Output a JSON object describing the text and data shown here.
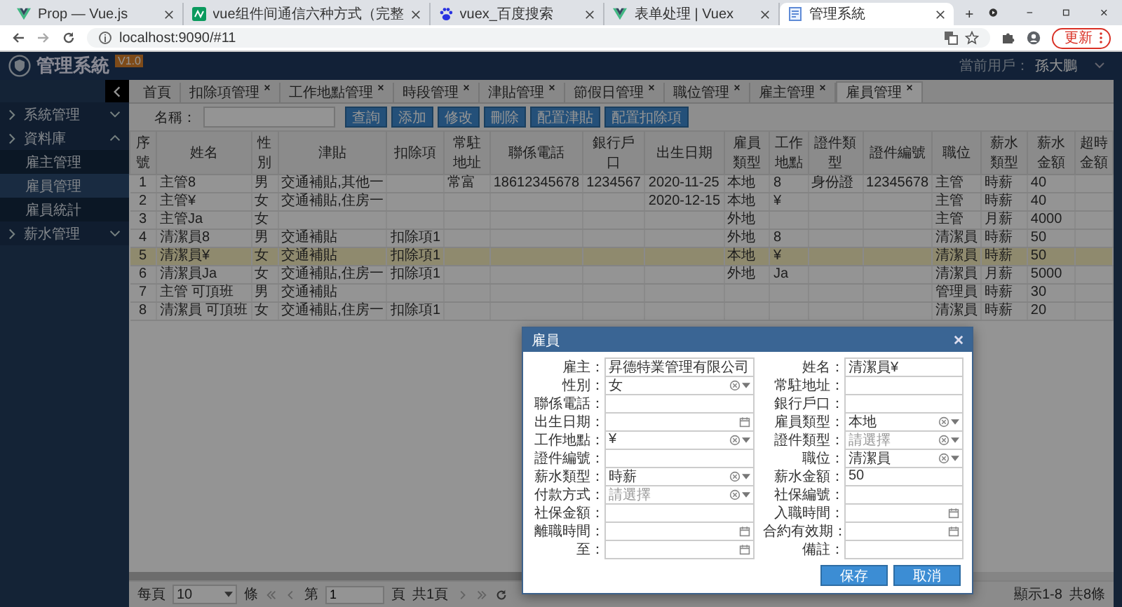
{
  "browser": {
    "tabs": [
      {
        "title": "Prop — Vue.js",
        "kind": "vue",
        "selected": false
      },
      {
        "title": "vue组件间通信六种方式（完整",
        "kind": "sf",
        "selected": false
      },
      {
        "title": "vuex_百度搜索",
        "kind": "paw",
        "selected": false
      },
      {
        "title": "表单处理 | Vuex",
        "kind": "vue",
        "selected": false
      },
      {
        "title": "管理系統",
        "kind": "page",
        "selected": true
      }
    ],
    "address": "localhost:9090/#11",
    "update_button": "更新"
  },
  "app": {
    "title": "管理系統",
    "version": "V1.0",
    "user_label": "當前用戶：",
    "user_name": "孫大鵬"
  },
  "sidebar": {
    "items": [
      {
        "label": "系統管理",
        "expanded": false
      },
      {
        "label": "資料庫",
        "expanded": true,
        "children": [
          {
            "label": "雇主管理",
            "selected": false
          },
          {
            "label": "雇員管理",
            "selected": true
          },
          {
            "label": "雇員統計",
            "selected": false
          }
        ]
      },
      {
        "label": "薪水管理",
        "expanded": false
      }
    ]
  },
  "tabs": [
    {
      "label": "首頁",
      "closable": false,
      "selected": false
    },
    {
      "label": "扣除項管理",
      "closable": true,
      "selected": false
    },
    {
      "label": "工作地點管理",
      "closable": true,
      "selected": false
    },
    {
      "label": "時段管理",
      "closable": true,
      "selected": false
    },
    {
      "label": "津貼管理",
      "closable": true,
      "selected": false
    },
    {
      "label": "節假日管理",
      "closable": true,
      "selected": false
    },
    {
      "label": "職位管理",
      "closable": true,
      "selected": false
    },
    {
      "label": "雇主管理",
      "closable": true,
      "selected": false
    },
    {
      "label": "雇員管理",
      "closable": true,
      "selected": true
    }
  ],
  "toolbar": {
    "label": "名稱：",
    "buttons": [
      "查詢",
      "添加",
      "修改",
      "刪除",
      "配置津貼",
      "配置扣除項"
    ]
  },
  "table": {
    "columns": [
      "序號",
      "姓名",
      "性別",
      "津貼",
      "扣除項",
      "常駐地址",
      "聯係電話",
      "銀行戶口",
      "出生日期",
      "雇員類型",
      "工作地點",
      "證件類型",
      "證件編號",
      "職位",
      "薪水類型",
      "薪水金額",
      "超時金額"
    ],
    "rows": [
      {
        "selected": false,
        "cells": [
          "1",
          "主管8",
          "男",
          "交通補貼,其他一",
          null,
          "常富",
          "18612345678",
          "1234567",
          "2020-11-25",
          "本地",
          "8",
          "身份證",
          "12345678",
          "主管",
          "時薪",
          "40",
          null
        ]
      },
      {
        "selected": false,
        "cells": [
          "2",
          "主管¥",
          "女",
          "交通補貼,住房一",
          null,
          null,
          null,
          null,
          "2020-12-15",
          "本地",
          "¥",
          null,
          null,
          "主管",
          "時薪",
          "40",
          null
        ]
      },
      {
        "selected": false,
        "cells": [
          "3",
          "主管Ja",
          "女",
          null,
          null,
          null,
          null,
          null,
          null,
          "外地",
          null,
          null,
          null,
          "主管",
          "月薪",
          "4000",
          null
        ]
      },
      {
        "selected": false,
        "cells": [
          "4",
          "清潔員8",
          "男",
          "交通補貼",
          "扣除項1",
          null,
          null,
          null,
          null,
          "外地",
          "8",
          null,
          null,
          "清潔員",
          "時薪",
          "50",
          null
        ]
      },
      {
        "selected": true,
        "cells": [
          "5",
          "清潔員¥",
          "女",
          "交通補貼",
          "扣除項1",
          null,
          null,
          null,
          null,
          "本地",
          "¥",
          null,
          null,
          "清潔員",
          "時薪",
          "50",
          null
        ]
      },
      {
        "selected": false,
        "cells": [
          "6",
          "清潔員Ja",
          "女",
          "交通補貼,住房一",
          "扣除項1",
          null,
          null,
          null,
          null,
          "外地",
          "Ja",
          null,
          null,
          "清潔員",
          "月薪",
          "5000",
          null
        ]
      },
      {
        "selected": false,
        "cells": [
          "7",
          "主管 可頂班",
          "男",
          "交通補貼",
          null,
          null,
          null,
          null,
          null,
          null,
          null,
          null,
          null,
          "管理員",
          "時薪",
          "30",
          null
        ]
      },
      {
        "selected": false,
        "cells": [
          "8",
          "清潔員 可頂班",
          "女",
          "交通補貼,住房一",
          "扣除項1",
          null,
          null,
          null,
          null,
          null,
          null,
          null,
          null,
          "清潔員",
          "時薪",
          "20",
          null
        ]
      }
    ]
  },
  "pager": {
    "per_page_label": "每頁",
    "per_page": "10",
    "rows_unit": "條",
    "page_label": "第",
    "page": "1",
    "page_unit": "頁",
    "total_pages": "共1頁",
    "summary": "顯示1-8",
    "total": "共8條"
  },
  "dialog": {
    "title": "雇員",
    "fields": [
      {
        "label": "雇主：",
        "kind": "text",
        "value": "昇德特業管理有限公司"
      },
      {
        "label": "姓名：",
        "kind": "text",
        "value": "清潔員¥"
      },
      {
        "label": "性別：",
        "kind": "select",
        "value": "女"
      },
      {
        "label": "常駐地址：",
        "kind": "text"
      },
      {
        "label": "聯係電話：",
        "kind": "text"
      },
      {
        "label": "銀行戶口：",
        "kind": "text"
      },
      {
        "label": "出生日期：",
        "kind": "date"
      },
      {
        "label": "雇員類型：",
        "kind": "select",
        "value": "本地"
      },
      {
        "label": "工作地點：",
        "kind": "select",
        "value": "¥"
      },
      {
        "label": "證件類型：",
        "kind": "select",
        "placeholder": "請選擇"
      },
      {
        "label": "證件編號：",
        "kind": "text"
      },
      {
        "label": "職位：",
        "kind": "select",
        "value": "清潔員"
      },
      {
        "label": "薪水類型：",
        "kind": "select",
        "value": "時薪"
      },
      {
        "label": "薪水金額：",
        "kind": "text",
        "value": "50"
      },
      {
        "label": "付款方式：",
        "kind": "select",
        "placeholder": "請選擇"
      },
      {
        "label": "社保編號：",
        "kind": "text"
      },
      {
        "label": "社保金額：",
        "kind": "text"
      },
      {
        "label": "入職時間：",
        "kind": "date"
      },
      {
        "label": "離職時間：",
        "kind": "date"
      },
      {
        "label": "合約有效期：",
        "kind": "date"
      },
      {
        "label": "至：",
        "kind": "date"
      },
      {
        "label": "備註：",
        "kind": "text"
      }
    ],
    "buttons": [
      "保存",
      "取消"
    ]
  }
}
